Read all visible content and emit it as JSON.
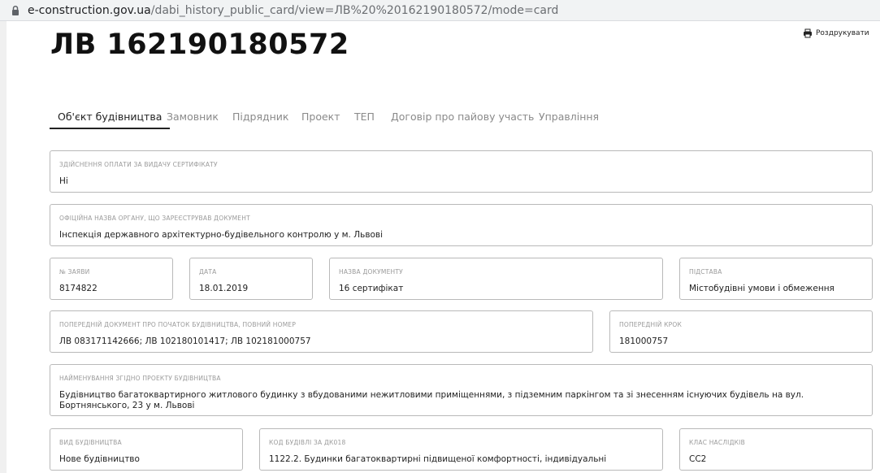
{
  "browser": {
    "url_host": "e-construction.gov.ua",
    "url_path": "/dabi_history_public_card/view=ЛВ%20%20162190180572/mode=card"
  },
  "page": {
    "title": "ЛВ 162190180572",
    "print_label": "Роздрукувати"
  },
  "tabs": [
    {
      "label": "Об'єкт будівництва",
      "active": true
    },
    {
      "label": "Замовник",
      "active": false
    },
    {
      "label": "Підрядник",
      "active": false
    },
    {
      "label": "Проект",
      "active": false
    },
    {
      "label": "ТЕП",
      "active": false
    },
    {
      "label": "Договір про пайову участь",
      "active": false
    },
    {
      "label": "Управління",
      "active": false
    }
  ],
  "fields": {
    "payment": {
      "label": "ЗДІЙСНЕННЯ ОПЛАТИ ЗА ВИДАЧУ СЕРТИФІКАТУ",
      "value": "Ні"
    },
    "authority": {
      "label": "ОФІЦІЙНА НАЗВА ОРГАНУ, ЩО ЗАРЕЄСТРУВАВ ДОКУМЕНТ",
      "value": "Інспекція державного архітектурно-будівельного контролю у м. Львові"
    },
    "application_no": {
      "label": "№ ЗАЯВИ",
      "value": "8174822"
    },
    "date": {
      "label": "ДАТА",
      "value": "18.01.2019"
    },
    "doc_name": {
      "label": "НАЗВА ДОКУМЕНТУ",
      "value": "16 сертифікат"
    },
    "basis": {
      "label": "ПІДСТАВА",
      "value": "Містобудівні умови і обмеження"
    },
    "prev_doc": {
      "label": "ПОПЕРЕДНІЙ ДОКУМЕНТ ПРО ПОЧАТОК БУДІВНИЦТВА, ПОВНИЙ НОМЕР",
      "value": "ЛВ 083171142666; ЛВ 102180101417; ЛВ 102181000757"
    },
    "prev_step": {
      "label": "ПОПЕРЕДНІЙ КРОК",
      "value": "181000757"
    },
    "project_name": {
      "label": "НАЙМЕНУВАННЯ ЗГІДНО ПРОЕКТУ БУДІВНИЦТВА",
      "value": "Будівництво багатоквартирного житлового будинку з вбудованими нежитловими приміщеннями, з підземним паркінгом та зі знесенням існуючих будівель на вул. Бортнянського, 23 у м. Львові"
    },
    "construction_type": {
      "label": "ВИД БУДІВНИЦТВА",
      "value": "Нове будівництво"
    },
    "building_code": {
      "label": "КОД БУДІВЛІ ЗА ДК018",
      "value": "1122.2. Будинки багатоквартирні підвищеної комфортності, індивідуальні"
    },
    "consequence_class": {
      "label": "КЛАС НАСЛІДКІВ",
      "value": "СС2"
    }
  }
}
